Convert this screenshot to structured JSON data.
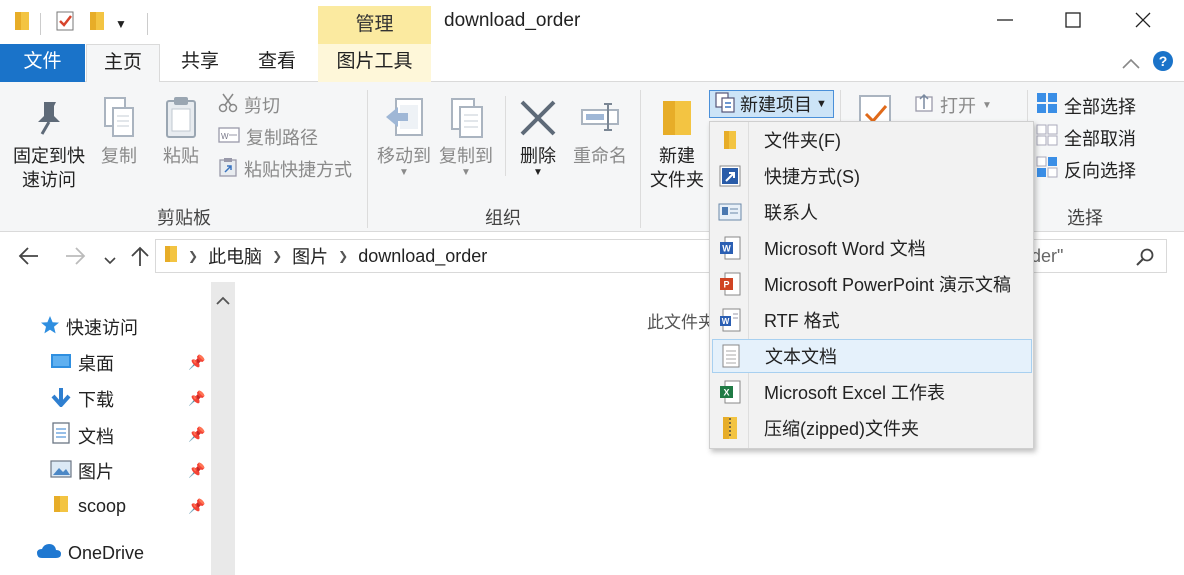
{
  "window": {
    "title": "download_order",
    "context_tab_group": "管理"
  },
  "tabs": {
    "file": "文件",
    "home": "主页",
    "share": "共享",
    "view": "查看",
    "picture_tools": "图片工具"
  },
  "ribbon": {
    "clipboard": {
      "label": "剪贴板",
      "pin": "固定到快\n速访问",
      "pin_l1": "固定到快",
      "pin_l2": "速访问",
      "copy": "复制",
      "paste": "粘贴",
      "cut": "剪切",
      "copy_path": "复制路径",
      "paste_shortcut": "粘贴快捷方式"
    },
    "organize": {
      "label": "组织",
      "move_to": "移动到",
      "copy_to": "复制到",
      "delete": "删除",
      "rename": "重命名"
    },
    "new": {
      "new_folder_l1": "新建",
      "new_folder_l2": "文件夹",
      "new_item": "新建项目"
    },
    "open": {
      "open": "打开"
    },
    "select": {
      "label": "选择",
      "select_all": "全部选择",
      "select_none": "全部取消",
      "invert": "反向选择"
    }
  },
  "address": {
    "crumbs": [
      "此电脑",
      "图片",
      "download_order"
    ],
    "search_placeholder": "der\""
  },
  "nav": {
    "quick_access": "快速访问",
    "items": [
      {
        "label": "桌面"
      },
      {
        "label": "下载"
      },
      {
        "label": "文档"
      },
      {
        "label": "图片"
      },
      {
        "label": "scoop"
      }
    ],
    "onedrive": "OneDrive"
  },
  "content": {
    "empty_message": "此文件夹"
  },
  "new_item_menu": {
    "items": [
      {
        "label": "文件夹(F)",
        "icon": "folder-icon"
      },
      {
        "label": "快捷方式(S)",
        "icon": "shortcut-icon"
      },
      {
        "label": "联系人",
        "icon": "contact-icon"
      },
      {
        "label": "Microsoft Word 文档",
        "icon": "word-icon"
      },
      {
        "label": "Microsoft PowerPoint 演示文稿",
        "icon": "powerpoint-icon"
      },
      {
        "label": "RTF 格式",
        "icon": "rtf-icon"
      },
      {
        "label": "文本文档",
        "icon": "text-document-icon"
      },
      {
        "label": "Microsoft Excel 工作表",
        "icon": "excel-icon"
      },
      {
        "label": "压缩(zipped)文件夹",
        "icon": "zip-folder-icon"
      }
    ],
    "highlighted_index": 6
  },
  "colors": {
    "accent": "#1a73c9",
    "context_tab": "#fbeaa0",
    "menu_highlight": "#e5f1fb"
  }
}
